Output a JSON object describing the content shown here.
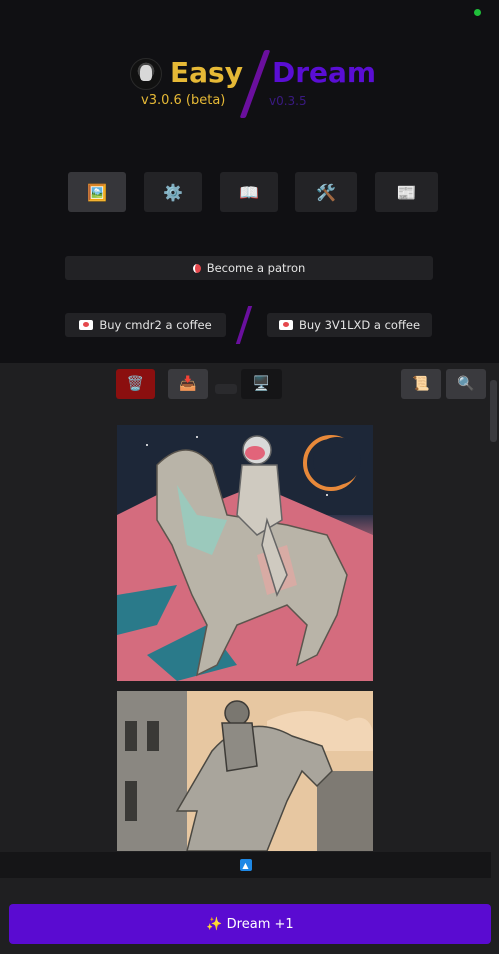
{
  "header": {
    "app_name_left": "Easy",
    "version_left": "v3.0.6 (beta)",
    "app_name_right": "Dream",
    "version_right": "v0.3.5"
  },
  "tabs": [
    {
      "icon": "image-icon",
      "glyph": "🖼️",
      "active": true
    },
    {
      "icon": "gear-icon",
      "glyph": "⚙️",
      "active": false
    },
    {
      "icon": "book-icon",
      "glyph": "📖",
      "active": false
    },
    {
      "icon": "tools-icon",
      "glyph": "🛠️",
      "active": false
    },
    {
      "icon": "news-icon",
      "glyph": "📰",
      "active": false
    }
  ],
  "support": {
    "patron_label": "Become a patron",
    "coffee1_label": "Buy cmdr2 a coffee",
    "coffee2_label": "Buy 3V1LXD a coffee"
  },
  "toolbar": {
    "clear_icon": "🗑️",
    "stop_icon": "📥",
    "view_icon": "🖥️",
    "scroll_icon": "📜",
    "search_icon": "🔍"
  },
  "bottom": {
    "collapse_glyph": "▲",
    "dream_label": "✨ Dream +1"
  },
  "colors": {
    "accent_gold": "#e6b936",
    "accent_purple": "#5a0bd1",
    "danger_red": "#8b0f0f"
  }
}
